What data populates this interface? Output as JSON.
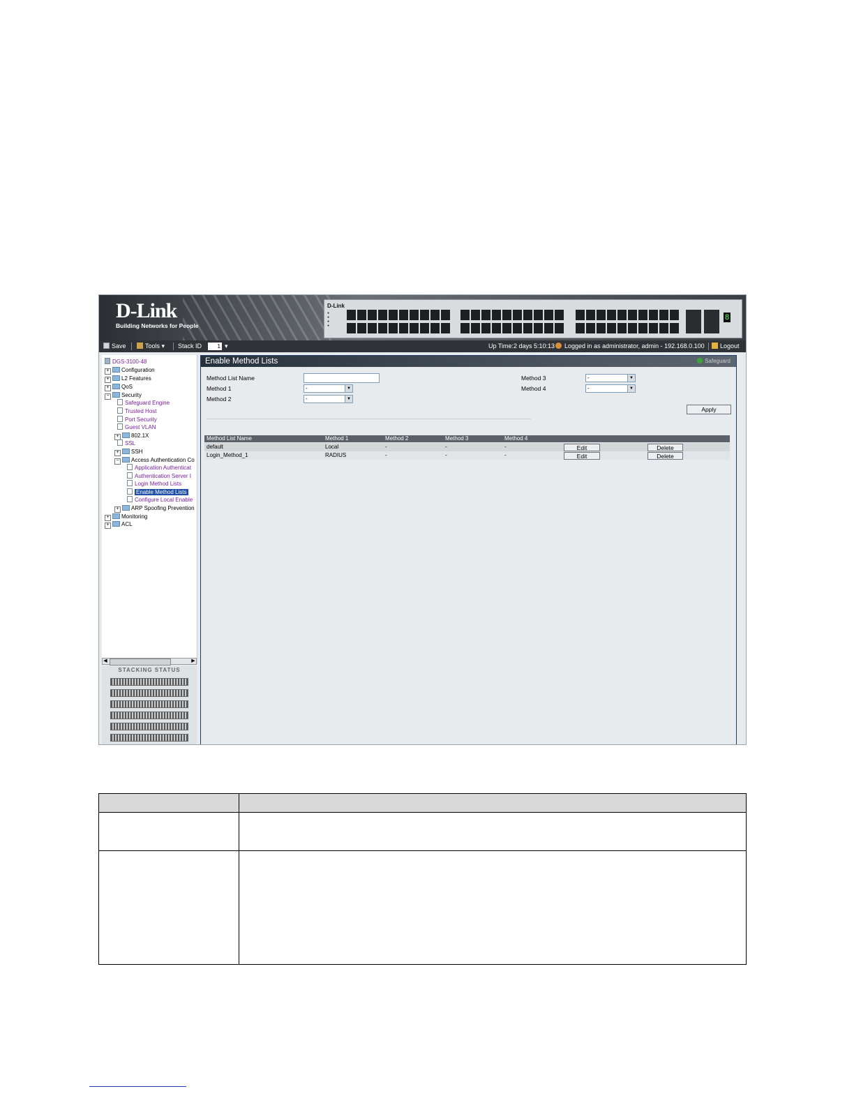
{
  "banner": {
    "brand": "D-Link",
    "tagline": "Building Networks for People",
    "device_logo": "D-Link"
  },
  "toolbar": {
    "save_label": "Save",
    "tools_label": "Tools",
    "stack_id_label": "Stack ID",
    "stack_id_value": "1",
    "uptime": "Up Time:2 days 5:10:13",
    "login_info": "Logged in as administrator, admin - 192.168.0.100",
    "logout_label": "Logout"
  },
  "tree": {
    "root": "DGS-3100-48",
    "items": [
      {
        "label": "Configuration"
      },
      {
        "label": "L2 Features"
      },
      {
        "label": "QoS"
      },
      {
        "label": "Security"
      },
      {
        "label": "Safeguard Engine"
      },
      {
        "label": "Trusted Host"
      },
      {
        "label": "Port Security"
      },
      {
        "label": "Guest VLAN"
      },
      {
        "label": "802.1X"
      },
      {
        "label": "SSL"
      },
      {
        "label": "SSH"
      },
      {
        "label": "Access Authentication Co"
      },
      {
        "label": "Application Authenticat"
      },
      {
        "label": "Authentication Server I"
      },
      {
        "label": "Login Method Lists"
      },
      {
        "label": "Enable Method Lists"
      },
      {
        "label": "Configure Local Enable"
      },
      {
        "label": "ARP Spoofing Prevention"
      },
      {
        "label": "Monitoring"
      },
      {
        "label": "ACL"
      }
    ],
    "selected": "Enable Method Lists"
  },
  "stacking": {
    "title": "Stacking Status",
    "units": 6
  },
  "main": {
    "title": "Enable Method Lists",
    "safeguard": "Safeguard",
    "form": {
      "method_list_name_label": "Method List Name",
      "method_list_name_value": "",
      "method1_label": "Method 1",
      "method1_value": "-",
      "method2_label": "Method 2",
      "method2_value": "-",
      "method3_label": "Method 3",
      "method3_value": "-",
      "method4_label": "Method 4",
      "method4_value": "-",
      "apply_label": "Apply"
    },
    "table": {
      "headers": [
        "Method List Name",
        "Method 1",
        "Method 2",
        "Method 3",
        "Method 4"
      ],
      "rows": [
        {
          "name": "default",
          "m1": "Local",
          "m2": "-",
          "m3": "-",
          "m4": "-"
        },
        {
          "name": "Login_Method_1",
          "m1": "RADIUS",
          "m2": "-",
          "m3": "-",
          "m4": "-"
        }
      ],
      "edit_label": "Edit",
      "delete_label": "Delete"
    }
  },
  "colors": {
    "titlebar": "#27313b",
    "table_header": "#5b6168",
    "selected_node": "#1f4fa8",
    "tree_link": "#7a1fa0"
  }
}
